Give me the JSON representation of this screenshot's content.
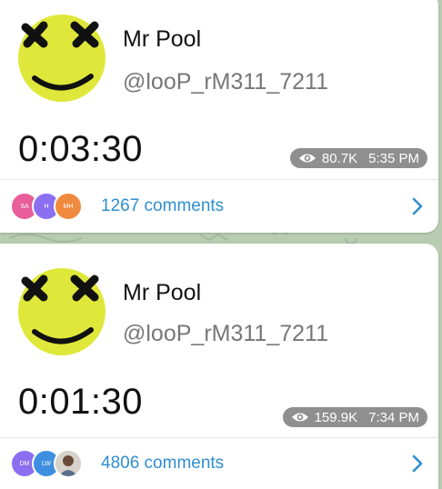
{
  "colors": {
    "accent": "#2f8ed0",
    "meta_badge": "#8f8f8f",
    "avatar_yellow": "#dfe83a"
  },
  "posts": [
    {
      "author": "Mr Pool",
      "handle": "@looP_rM311_7211",
      "duration": "0:03:30",
      "views": "80.7K",
      "time": "5:35 PM",
      "comments": "1267 comments",
      "commenters": [
        {
          "initials": "SA",
          "color": "#e85d9a"
        },
        {
          "initials": "H",
          "color": "#8a6ff0"
        },
        {
          "initials": "MH",
          "color": "#f08a3e"
        }
      ]
    },
    {
      "author": "Mr Pool",
      "handle": "@looP_rM311_7211",
      "duration": "0:01:30",
      "views": "159.9K",
      "time": "7:34 PM",
      "comments": "4806 comments",
      "commenters": [
        {
          "initials": "DM",
          "color": "#8a6ff0"
        },
        {
          "initials": "LW",
          "color": "#3f8fe0"
        },
        {
          "initials": "",
          "color": "#c9c3bd",
          "photo": true
        }
      ]
    }
  ]
}
